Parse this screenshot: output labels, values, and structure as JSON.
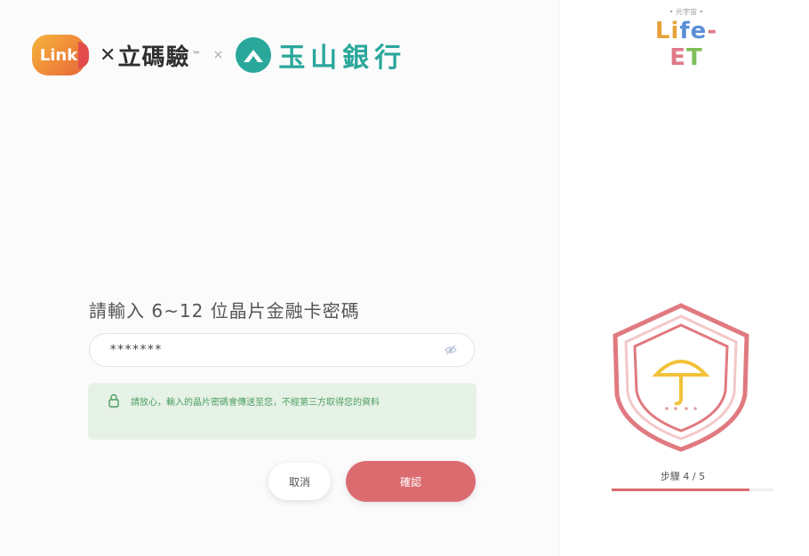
{
  "brand": {
    "link_logo_text": "Link",
    "partner_name": "立碼驗",
    "partner_mark": "™",
    "times_sign": "×",
    "bank_name": "玉山銀行",
    "bank_color": "#2aa79b"
  },
  "form": {
    "prompt": "請輸入 6~12 位晶片金融卡密碼",
    "password_value": "*******",
    "notice": "請放心，輸入的晶片密碼會傳送至您，不經第三方取得您的資料",
    "cancel_label": "取消",
    "confirm_label": "確認"
  },
  "sidebar": {
    "small_caption": "• 元宇宙 •",
    "logo_letters": [
      "Li",
      "fe",
      "-E",
      "T"
    ],
    "step_label": "步驟 4 / 5",
    "progress": 0.85,
    "accent": "#dc6b70"
  }
}
